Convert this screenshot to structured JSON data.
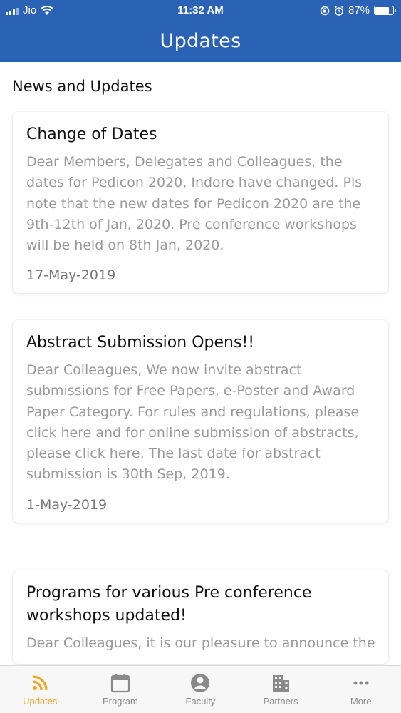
{
  "status_bar": {
    "carrier": "Jio",
    "time": "11:32 AM",
    "battery_percent": "87%",
    "battery_level": 0.87
  },
  "header": {
    "title": "Updates"
  },
  "section_title": "News and Updates",
  "updates": [
    {
      "title": "Change of Dates",
      "body": "Dear Members, Delegates and Colleagues, the dates for Pedicon 2020, Indore have changed. Pls note that the new dates for Pedicon 2020 are the 9th-12th of Jan, 2020. Pre conference workshops will be held on 8th Jan, 2020.",
      "date": "17-May-2019"
    },
    {
      "title": "Abstract Submission Opens!!",
      "body": "Dear Colleagues, We now invite abstract submissions for Free Papers, e-Poster and Award Paper Category. For rules and regulations, please click here and for online submission of abstracts, please click here. The last date for abstract submission is 30th Sep, 2019.",
      "date": "1-May-2019"
    },
    {
      "title": "Programs for various Pre conference workshops updated!",
      "body": "Dear Colleagues, it is our pleasure to announce the",
      "date": ""
    }
  ],
  "tabs": [
    {
      "label": "Updates",
      "icon": "rss-icon",
      "active": true
    },
    {
      "label": "Program",
      "icon": "calendar-icon",
      "active": false
    },
    {
      "label": "Faculty",
      "icon": "user-icon",
      "active": false
    },
    {
      "label": "Partners",
      "icon": "building-icon",
      "active": false
    },
    {
      "label": "More",
      "icon": "more-icon",
      "active": false
    }
  ],
  "colors": {
    "primary": "#2a63b6",
    "active_tab": "#f3a521",
    "inactive_tab": "#8a8a8a",
    "body_text": "#9a9a9a"
  }
}
